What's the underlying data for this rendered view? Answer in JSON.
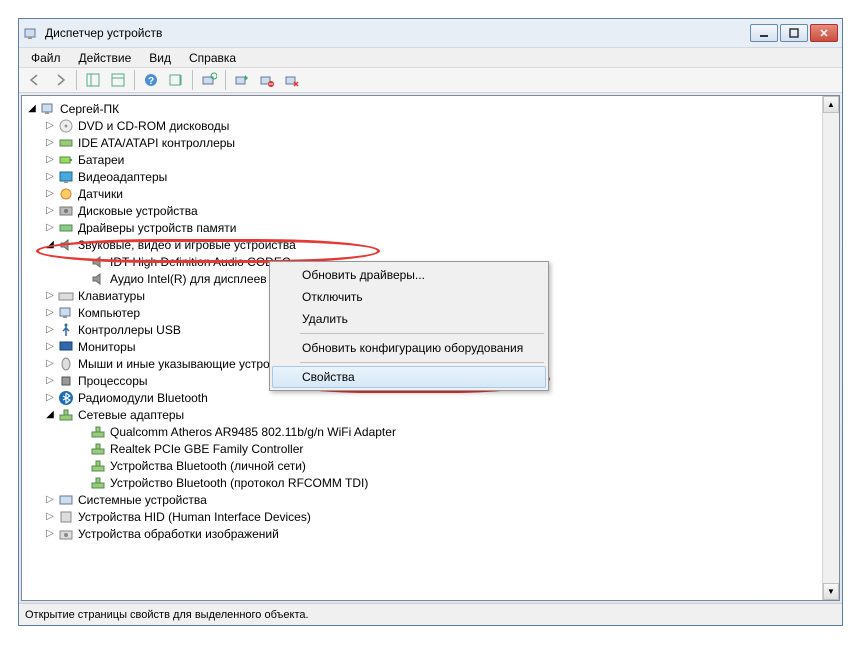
{
  "window": {
    "title": "Диспетчер устройств"
  },
  "menu": {
    "file": "Файл",
    "action": "Действие",
    "view": "Вид",
    "help": "Справка"
  },
  "tree": {
    "root": "Сергей-ПК",
    "nodes": [
      {
        "label": "DVD и CD-ROM дисководы"
      },
      {
        "label": "IDE ATA/ATAPI контроллеры"
      },
      {
        "label": "Батареи"
      },
      {
        "label": "Видеоадаптеры"
      },
      {
        "label": "Датчики"
      },
      {
        "label": "Дисковые устройства"
      },
      {
        "label": "Драйверы устройств памяти"
      },
      {
        "label": "Звуковые, видео и игровые устройства",
        "expanded": true,
        "children": [
          {
            "label": "IDT High Definition Audio CODEC"
          },
          {
            "label": "Аудио Intel(R) для дисплеев"
          }
        ]
      },
      {
        "label": "Клавиатуры"
      },
      {
        "label": "Компьютер"
      },
      {
        "label": "Контроллеры USB"
      },
      {
        "label": "Мониторы"
      },
      {
        "label": "Мыши и иные указывающие устройства"
      },
      {
        "label": "Процессоры"
      },
      {
        "label": "Радиомодули Bluetooth"
      },
      {
        "label": "Сетевые адаптеры",
        "expanded": true,
        "children": [
          {
            "label": "Qualcomm Atheros AR9485 802.11b/g/n WiFi Adapter"
          },
          {
            "label": "Realtek PCIe GBE Family Controller"
          },
          {
            "label": "Устройства Bluetooth (личной сети)"
          },
          {
            "label": "Устройство Bluetooth (протокол RFCOMM TDI)"
          }
        ]
      },
      {
        "label": "Системные устройства"
      },
      {
        "label": "Устройства HID (Human Interface Devices)"
      },
      {
        "label": "Устройства обработки изображений"
      }
    ]
  },
  "context_menu": {
    "update_drivers": "Обновить драйверы...",
    "disable": "Отключить",
    "delete": "Удалить",
    "refresh_config": "Обновить конфигурацию оборудования",
    "properties": "Свойства"
  },
  "status": {
    "text": "Открытие страницы свойств для выделенного объекта."
  }
}
